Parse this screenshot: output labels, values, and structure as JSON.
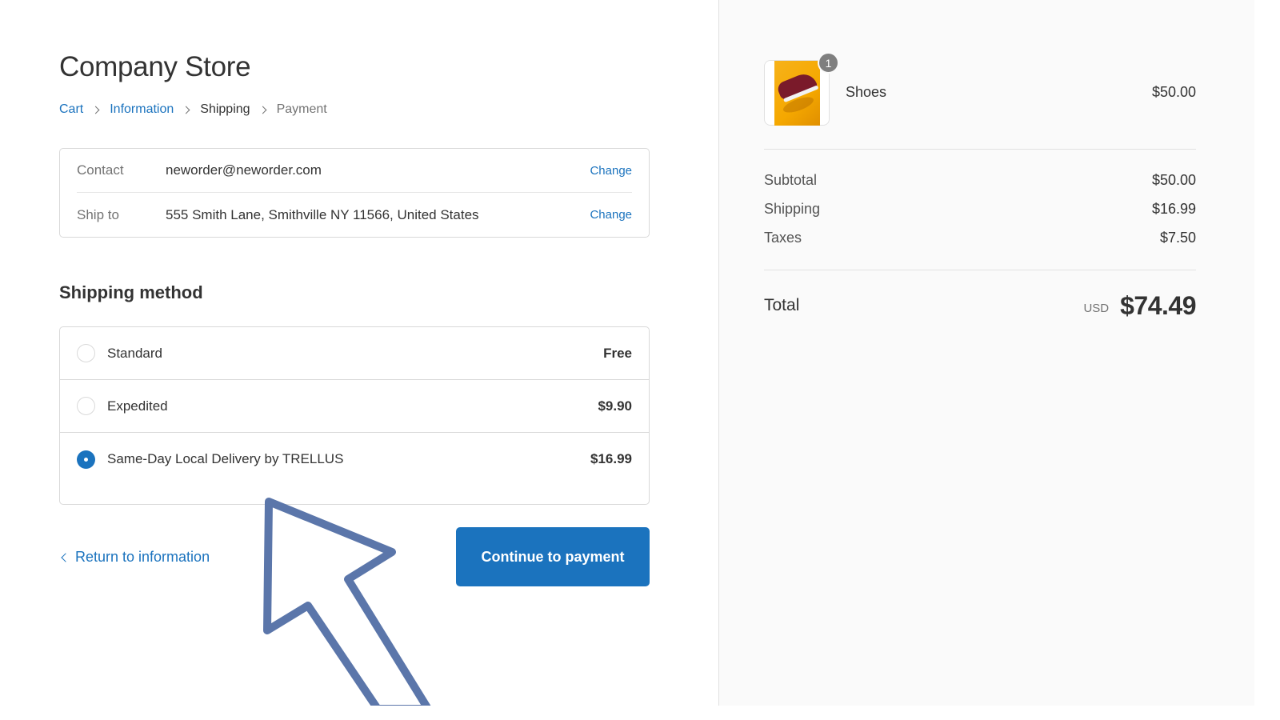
{
  "store": {
    "title": "Company Store"
  },
  "breadcrumb": [
    {
      "label": "Cart",
      "state": "link"
    },
    {
      "label": "Information",
      "state": "link"
    },
    {
      "label": "Shipping",
      "state": "current"
    },
    {
      "label": "Payment",
      "state": "future"
    }
  ],
  "review": {
    "contact": {
      "label": "Contact",
      "value": "neworder@neworder.com",
      "action": "Change"
    },
    "ship_to": {
      "label": "Ship to",
      "value": "555 Smith Lane, Smithville NY 11566, United States",
      "action": "Change"
    }
  },
  "shipping": {
    "title": "Shipping method",
    "options": [
      {
        "name": "Standard",
        "price": "Free",
        "selected": false
      },
      {
        "name": "Expedited",
        "price": "$9.90",
        "selected": false
      },
      {
        "name": "Same-Day Local Delivery by TRELLUS",
        "price": "$16.99",
        "selected": true
      }
    ]
  },
  "actions": {
    "return_label": "Return to information",
    "continue_label": "Continue to payment"
  },
  "summary": {
    "product": {
      "name": "Shoes",
      "price": "$50.00",
      "quantity": "1",
      "image": "shoe-product-image"
    },
    "subtotal": {
      "label": "Subtotal",
      "value": "$50.00"
    },
    "shipping": {
      "label": "Shipping",
      "value": "$16.99"
    },
    "taxes": {
      "label": "Taxes",
      "value": "$7.50"
    },
    "total": {
      "label": "Total",
      "currency": "USD",
      "value": "$74.49"
    }
  },
  "colors": {
    "accent": "#1b73be",
    "annotation_arrow": "#5b76aa",
    "sidebar_bg": "#fafafa"
  }
}
